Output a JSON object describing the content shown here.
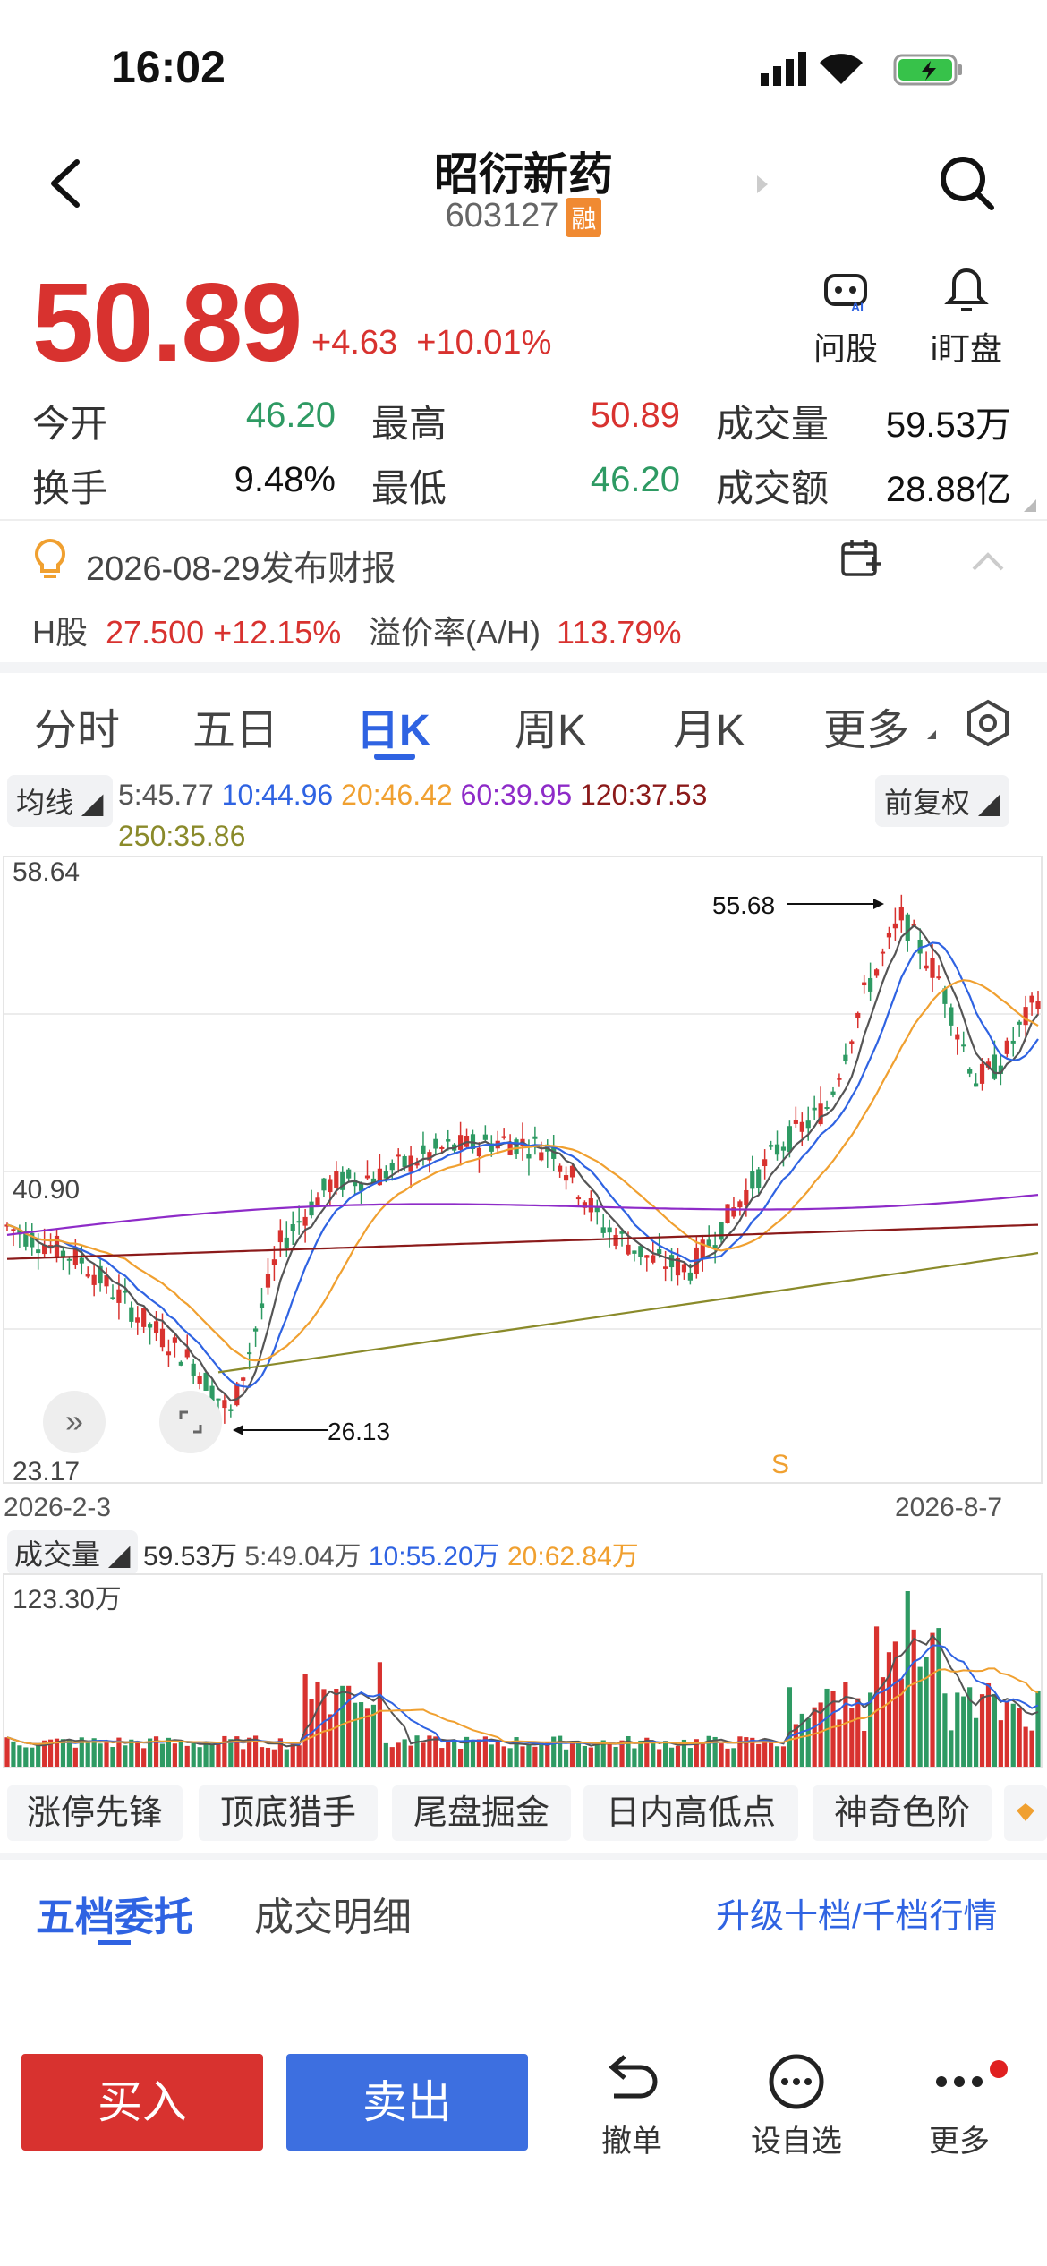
{
  "status_bar": {
    "time": "16:02"
  },
  "header": {
    "title": "昭衍新药",
    "code": "603127",
    "margin_badge": "融"
  },
  "quote": {
    "price": "50.89",
    "change": "+4.63",
    "change_pct": "+10.01%"
  },
  "actions": [
    {
      "icon": "ai-robot-icon",
      "label": "问股"
    },
    {
      "icon": "bell-icon",
      "label": "i盯盘"
    }
  ],
  "stats": {
    "open_label": "今开",
    "open": "46.20",
    "high_label": "最高",
    "high": "50.89",
    "volume_label": "成交量",
    "volume": "59.53万",
    "turnover_label": "换手",
    "turnover": "9.48%",
    "low_label": "最低",
    "low": "46.20",
    "amount_label": "成交额",
    "amount": "28.88亿"
  },
  "notice": {
    "text": "2026-08-29发布财报"
  },
  "hshare": {
    "label": "H股",
    "price": "27.500",
    "pct": "+12.15%",
    "premium_label": "溢价率(A/H)",
    "premium": "113.79%"
  },
  "tabs": [
    "分时",
    "五日",
    "日K",
    "周K",
    "月K",
    "更多"
  ],
  "active_tab": "日K",
  "ma": {
    "selector": "均线",
    "ma5": "5:45.77",
    "ma10": "10:44.96",
    "ma20": "20:46.42",
    "ma60": "60:39.95",
    "ma120": "120:37.53",
    "ma250": "250:35.86",
    "adjust": "前复权"
  },
  "chart_data": {
    "type": "candlestick",
    "y_axis_labels": [
      "58.64",
      "40.90",
      "23.17"
    ],
    "start_date": "2026-2-3",
    "end_date": "2026-8-7",
    "high_marker": "55.68",
    "low_marker": "26.13",
    "signal": "S",
    "colors": {
      "up": "#d8322f",
      "down": "#2e9a63",
      "ma5": "#555555",
      "ma10": "#2f63e2",
      "ma20": "#f0a030",
      "ma60": "#8e2bc8",
      "ma120": "#8b1a1a",
      "ma250": "#8a8a2a"
    }
  },
  "volume": {
    "selector": "成交量",
    "vol": "59.53万",
    "ma5": "5:49.04万",
    "ma10": "10:55.20万",
    "ma20": "20:62.84万",
    "max_label": "123.30万"
  },
  "func_buttons": [
    "涨停先锋",
    "顶底猎手",
    "尾盘掘金",
    "日内高低点",
    "神奇色阶"
  ],
  "bottom_tabs": {
    "t1": "五档委托",
    "t2": "成交明细",
    "upgrade": "升级十档/千档行情"
  },
  "toolbar": {
    "buy": "买入",
    "sell": "卖出",
    "cancel": "撤单",
    "watch": "设自选",
    "more": "更多"
  }
}
